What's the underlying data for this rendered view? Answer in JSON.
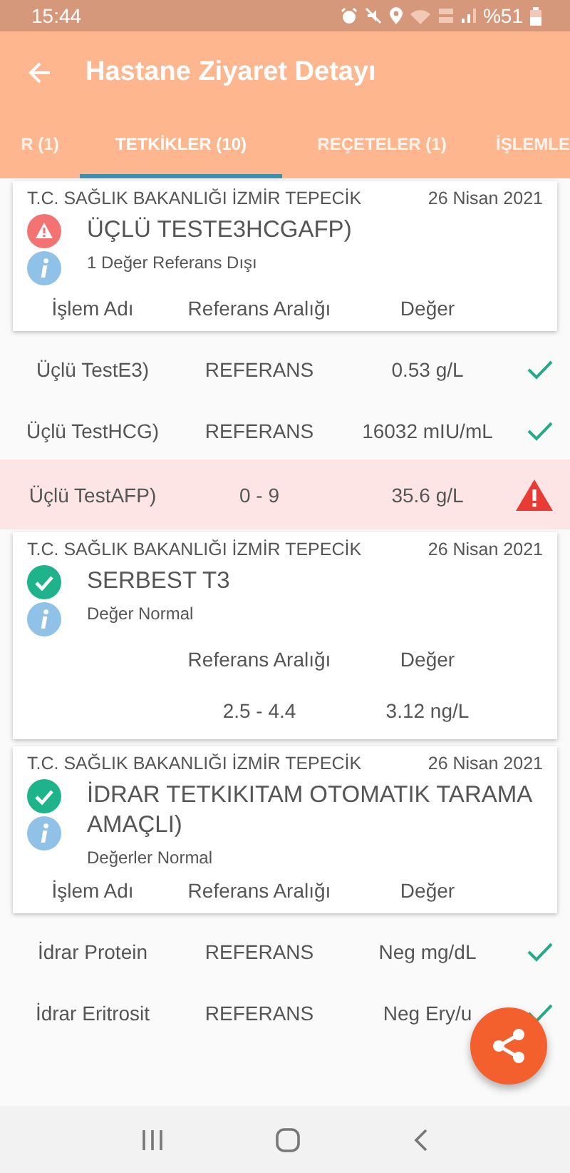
{
  "status_bar": {
    "time": "15:44",
    "battery": "%51"
  },
  "app_bar": {
    "title": "Hastane Ziyaret Detayı"
  },
  "tabs": [
    {
      "label": "R (1)",
      "selected": false
    },
    {
      "label": "TETKİKLER (10)",
      "selected": true
    },
    {
      "label": "REÇETELER (1)",
      "selected": false
    },
    {
      "label": "İŞLEMLE",
      "selected": false
    }
  ],
  "tests": [
    {
      "hospital": "T.C. SAĞLIK BAKANLIĞI  İZMİR TEPECİK",
      "date": "26 Nisan 2021",
      "kind": "warning",
      "title": "ÜÇLÜ TESTE3HCGAFP)",
      "info": "1 Değer Referans Dışı",
      "columns": [
        {
          "kind": "name",
          "label": "İşlem Adı"
        },
        {
          "kind": "range",
          "label": "Referans Aralığı"
        },
        {
          "kind": "value",
          "label": "Değer"
        }
      ],
      "rows": [
        {
          "name": "Üçlü TestE3)",
          "range": "REFERANS",
          "value": "0.53 g/L",
          "kind": "normal"
        },
        {
          "name": "Üçlü TestHCG)",
          "range": "REFERANS",
          "value": "16032 mIU/mL",
          "kind": "normal"
        },
        {
          "name": "Üçlü TestAFP)",
          "range": "0 - 9",
          "value": "35.6 g/L",
          "kind": "abnormal"
        }
      ]
    },
    {
      "hospital": "T.C. SAĞLIK BAKANLIĞI  İZMİR TEPECİK",
      "date": "26 Nisan 2021",
      "kind": "normal",
      "title": "SERBEST T3",
      "info": "Değer Normal",
      "columns": [
        {
          "kind": "range",
          "label": "Referans Aralığı"
        },
        {
          "kind": "value",
          "label": "Değer"
        }
      ],
      "rows": [
        {
          "range": "2.5 - 4.4",
          "value": "3.12 ng/L",
          "kind": "plain"
        }
      ]
    },
    {
      "hospital": "T.C. SAĞLIK BAKANLIĞI  İZMİR TEPECİK",
      "date": "26 Nisan 2021",
      "kind": "normal",
      "title": "İDRAR TETKIKITAM OTOMATIK TARAMA AMAÇLI)",
      "info": "Değerler Normal",
      "columns": [
        {
          "kind": "name",
          "label": "İşlem Adı"
        },
        {
          "kind": "range",
          "label": "Referans Aralığı"
        },
        {
          "kind": "value",
          "label": "Değer"
        }
      ],
      "rows": [
        {
          "name": "İdrar Protein",
          "range": "REFERANS",
          "value": "Neg mg/dL",
          "kind": "normal"
        },
        {
          "name": "İdrar Eritrosit",
          "range": "REFERANS",
          "value": "Neg Ery/u",
          "kind": "normal"
        }
      ]
    }
  ]
}
